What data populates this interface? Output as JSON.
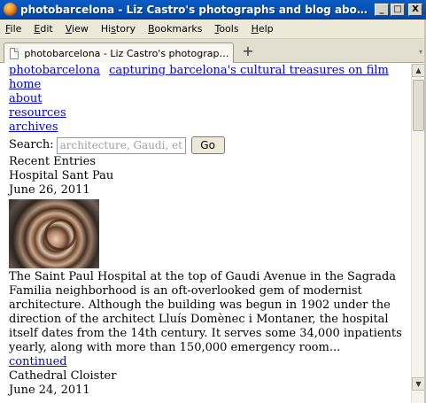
{
  "window": {
    "title": "photobarcelona - Liz Castro's photographs and blog about Barcelon...",
    "minimize": "_",
    "maximize": "□",
    "close": "X"
  },
  "menu": {
    "items": [
      {
        "label": "File",
        "accel": "F",
        "rest": "ile"
      },
      {
        "label": "Edit",
        "accel": "E",
        "rest": "dit"
      },
      {
        "label": "View",
        "accel": "V",
        "rest": "iew"
      },
      {
        "label": "History",
        "accel": "s",
        "pre": "Hi",
        "rest": "tory"
      },
      {
        "label": "Bookmarks",
        "accel": "B",
        "rest": "ookmarks"
      },
      {
        "label": "Tools",
        "accel": "T",
        "rest": "ools"
      },
      {
        "label": "Help",
        "accel": "H",
        "rest": "elp"
      }
    ]
  },
  "tabs": {
    "active_label": "photobarcelona - Liz Castro's photographs a...",
    "new_tab": "+",
    "scroll_arrow": "▾"
  },
  "page": {
    "site_name": "photobarcelona",
    "tagline": "capturing barcelona's cultural treasures on film",
    "nav": [
      "home",
      "about",
      "resources",
      "archives"
    ],
    "search": {
      "label": "Search:",
      "placeholder": "architecture, Gaudi, etc.",
      "button": "Go"
    },
    "recent_heading": "Recent Entries",
    "entries": [
      {
        "title": "Hospital Sant Pau",
        "date": "June 26, 2011",
        "body": "The Saint Paul Hospital at the top of Gaudi Avenue in the Sagrada Familia neighborhood is an oft-overlooked gem of modernist architecture. Although the building was begun in 1902 under the direction of the architect Lluís Domènec i Montaner, the hospital itself dates from the 14th century. It serves some 34,000 inpatients yearly, along with more than 150,000 emergency room...",
        "more": "continued"
      },
      {
        "title": "Cathedral Cloister",
        "date": "June 24, 2011"
      }
    ]
  },
  "scrollbar": {
    "up": "▲",
    "down": "▼"
  }
}
